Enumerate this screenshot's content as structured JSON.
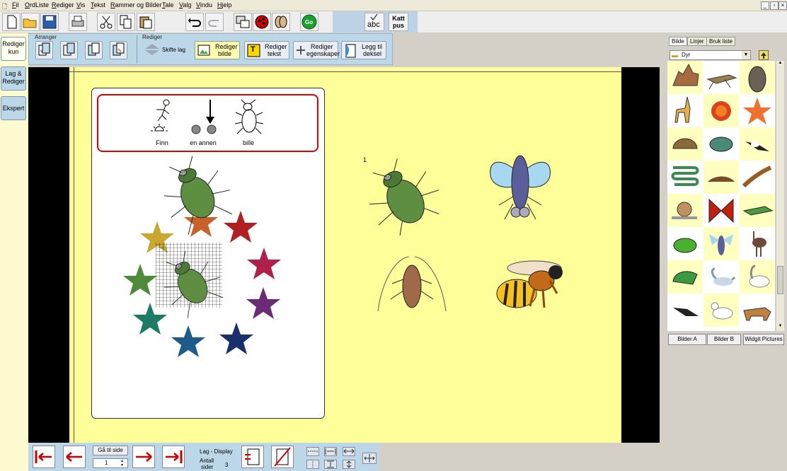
{
  "menubar": {
    "items": [
      "Fil",
      "OrdListe",
      "Rediger",
      "Vis",
      "Tekst",
      "Rammer og Bilder",
      "Tale",
      "Valg",
      "Vindu",
      "Hjelp"
    ]
  },
  "toolbar": {
    "spell_label": "abc",
    "cat_label_1": "Katt",
    "cat_label_2": "pus",
    "go_label": "Go"
  },
  "modes": {
    "rediger_kun": [
      "Rediger",
      "kun"
    ],
    "lag_rediger": [
      "Lag &",
      "Rediger"
    ],
    "ekspert": "Ekspert"
  },
  "ribbon": {
    "group_arranger": "Arranger",
    "group_rediger": "Rediger",
    "skifte_lag": "Skifte lag",
    "rediger_bilde": [
      "Rediger",
      "bilde"
    ],
    "rediger_tekst": [
      "Rediger",
      "tekst"
    ],
    "rediger_egenskaper": [
      "Rediger",
      "egenskaper"
    ],
    "legg_til_deksel": [
      "Legg til",
      "deksel"
    ]
  },
  "card": {
    "symbols": [
      "Finn",
      "en annen",
      "bille"
    ]
  },
  "frame_number": "1",
  "right_panel": {
    "tabs": [
      "Bilde",
      "Linjer",
      "Bruk liste"
    ],
    "folder": "Dyr",
    "animals": [
      "wolf",
      "grasshopper",
      "gorilla",
      "giraffe",
      "anemone",
      "starfish",
      "tortoise",
      "turtle",
      "magpie",
      "snake",
      "slug",
      "leech",
      "snail",
      "butterfly",
      "lizard",
      "frog",
      "fly",
      "ostrich",
      "dinosaur",
      "swan",
      "goose",
      "crow",
      "duck",
      "thylacine"
    ],
    "buttons": [
      "Bilder A",
      "Bilder B",
      "Widgit Pictures"
    ]
  },
  "bottom": {
    "goto_page": "Gå til side",
    "page_value": "1",
    "mode_label": "Lag - Display",
    "count_label_1": "Antall",
    "count_label_2": "sider",
    "count_value": "3"
  },
  "colors": {
    "page": "#ffff99",
    "panel_blue": "#bcd7e8",
    "border_red": "#dd0000"
  }
}
